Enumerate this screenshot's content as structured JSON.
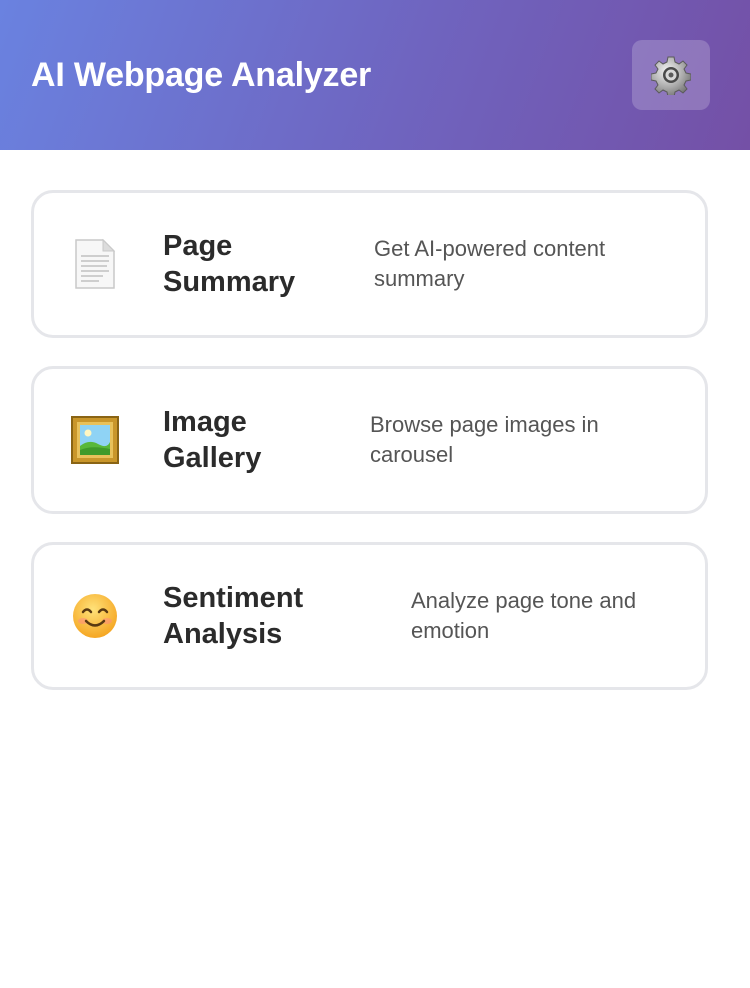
{
  "header": {
    "title": "AI Webpage Analyzer",
    "settings_icon": "gear-icon",
    "gradient": [
      "#6a82e0",
      "#7450a6"
    ]
  },
  "cards": [
    {
      "icon": "document-icon",
      "title": "Page Summary",
      "description": "Get AI-powered content summary"
    },
    {
      "icon": "framed-picture-icon",
      "title": "Image Gallery",
      "description": "Browse page images in carousel"
    },
    {
      "icon": "smiling-face-icon",
      "title": "Sentiment Analysis",
      "description": "Analyze page tone and emotion"
    }
  ]
}
